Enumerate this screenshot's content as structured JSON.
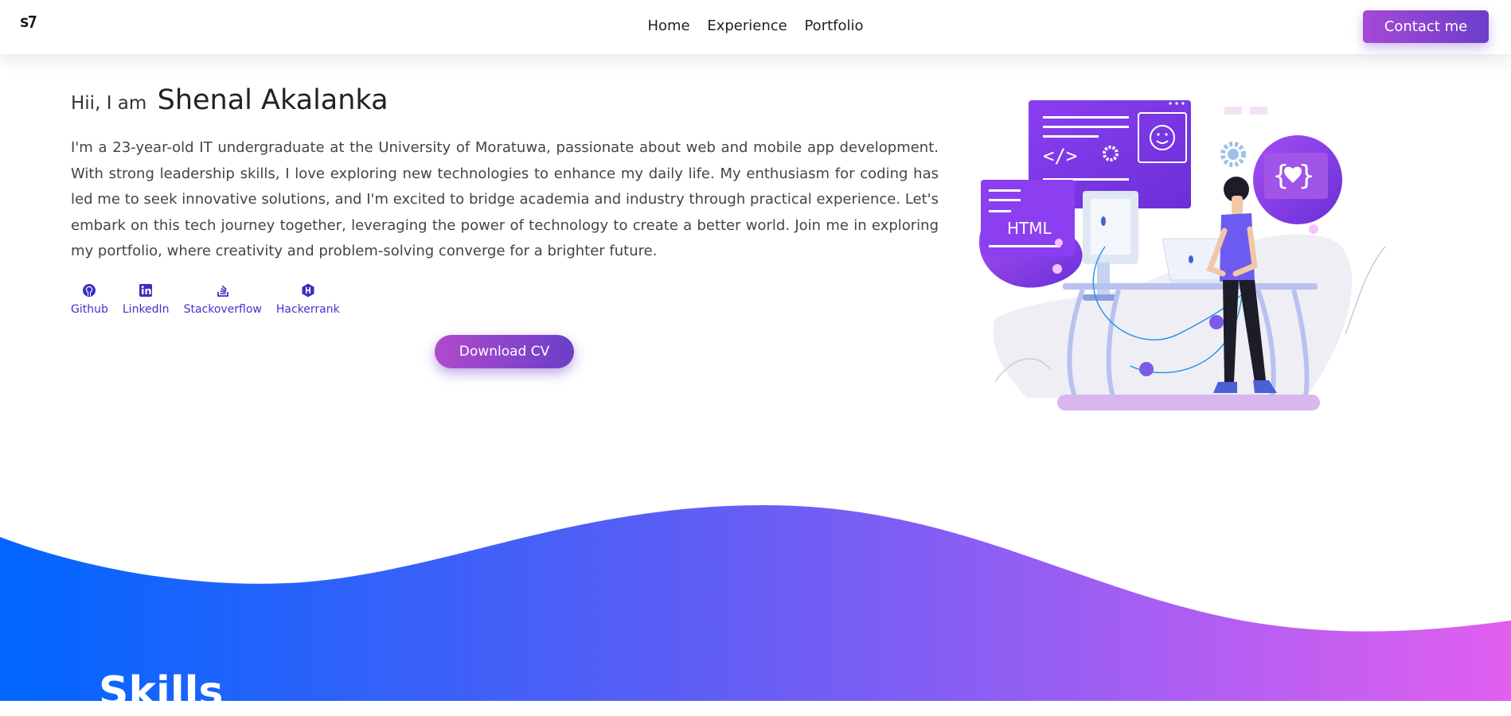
{
  "nav": {
    "logo_icon": "brand-logo-icon",
    "links": [
      "Home",
      "Experience",
      "Portfolio"
    ],
    "contact_label": "Contact me"
  },
  "hero": {
    "greeting": "Hii, I am",
    "name": "Shenal Akalanka",
    "bio": "I'm a 23-year-old IT undergraduate at the University of Moratuwa, passionate about web and mobile app development. With strong leadership skills, I love exploring new technologies to enhance my daily life. My enthusiasm for coding has led me to seek innovative solutions, and I'm excited to bridge academia and industry through practical experience. Let's embark on this tech journey together, leveraging the power of technology to create a better world. Join me in exploring my portfolio, where creativity and problem-solving converge for a brighter future.",
    "socials": [
      {
        "label": "Github",
        "icon": "github-icon"
      },
      {
        "label": "LinkedIn",
        "icon": "linkedin-icon"
      },
      {
        "label": "Stackoverflow",
        "icon": "stackoverflow-icon"
      },
      {
        "label": "Hackerrank",
        "icon": "hackerrank-icon"
      }
    ],
    "download_label": "Download CV"
  },
  "illustration": {
    "html_tag": "HTML",
    "code_tag": "</>",
    "braces": "{ }"
  },
  "skills": {
    "title": "Skills"
  },
  "colors": {
    "accent": "#6a3fc9",
    "gradient_start": "#0066ff",
    "gradient_end": "#e15ff0",
    "link": "#4b2fc9"
  }
}
